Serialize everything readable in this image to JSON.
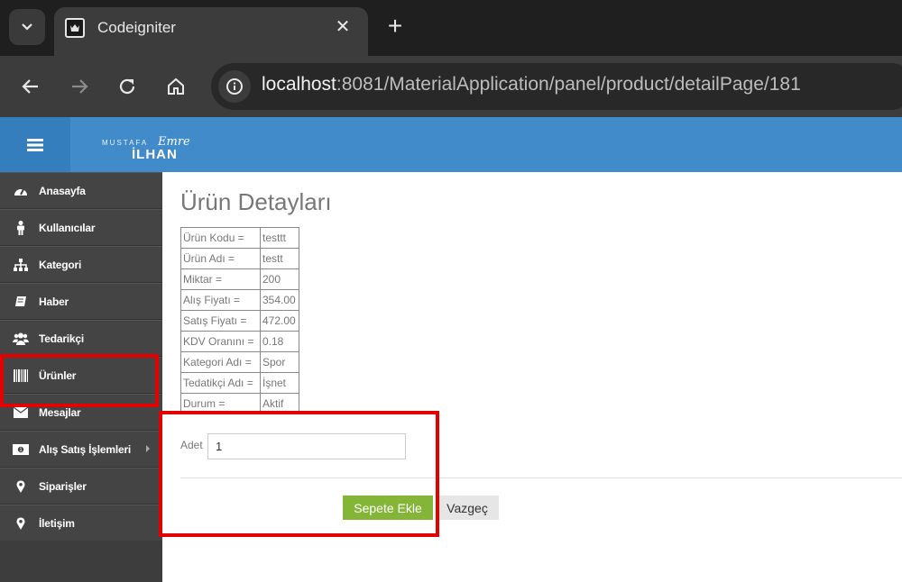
{
  "browser": {
    "tab_title": "Codeigniter",
    "tab_close": "✕",
    "new_tab": "+",
    "url_host": "localhost",
    "url_rest": ":8081/MaterialApplication/panel/product/detailPage/181"
  },
  "header": {
    "logo_top": "MUSTAFA",
    "logo_script": "Emre",
    "logo_main": "İLHAN",
    "accent_color": "#428bca"
  },
  "sidebar": {
    "items": [
      {
        "label": "Anasayfa",
        "icon": "dashboard-icon"
      },
      {
        "label": "Kullanıcılar",
        "icon": "user-icon"
      },
      {
        "label": "Kategori",
        "icon": "sitemap-icon"
      },
      {
        "label": "Haber",
        "icon": "book-icon"
      },
      {
        "label": "Tedarikçi",
        "icon": "users-icon"
      },
      {
        "label": "Ürünler",
        "icon": "barcode-icon"
      },
      {
        "label": "Mesajlar",
        "icon": "envelope-icon"
      },
      {
        "label": "Alış Satış İşlemleri",
        "icon": "money-icon"
      },
      {
        "label": "Siparişler",
        "icon": "map-marker-icon"
      },
      {
        "label": "İletişim",
        "icon": "map-marker-icon"
      }
    ]
  },
  "main": {
    "title": "Ürün Detayları",
    "details": [
      {
        "key": "Ürün Kodu =",
        "value": "testtt"
      },
      {
        "key": "Ürün Adı =",
        "value": "testt"
      },
      {
        "key": "Miktar =",
        "value": "200"
      },
      {
        "key": "Alış Fiyatı =",
        "value": "354.00"
      },
      {
        "key": "Satış Fiyatı =",
        "value": "472.00"
      },
      {
        "key": "KDV Oranını =",
        "value": "0.18"
      },
      {
        "key": "Kategori Adı =",
        "value": "Spor"
      },
      {
        "key": "Tedatikçi Adı =",
        "value": "İşnet"
      },
      {
        "key": "Durum =",
        "value": "Aktif"
      }
    ],
    "quantity_label": "Adet",
    "quantity_value": "1",
    "add_to_cart": "Sepete Ekle",
    "cancel": "Vazgeç",
    "add_button_color": "#84b537",
    "highlight_color": "#e20000"
  }
}
